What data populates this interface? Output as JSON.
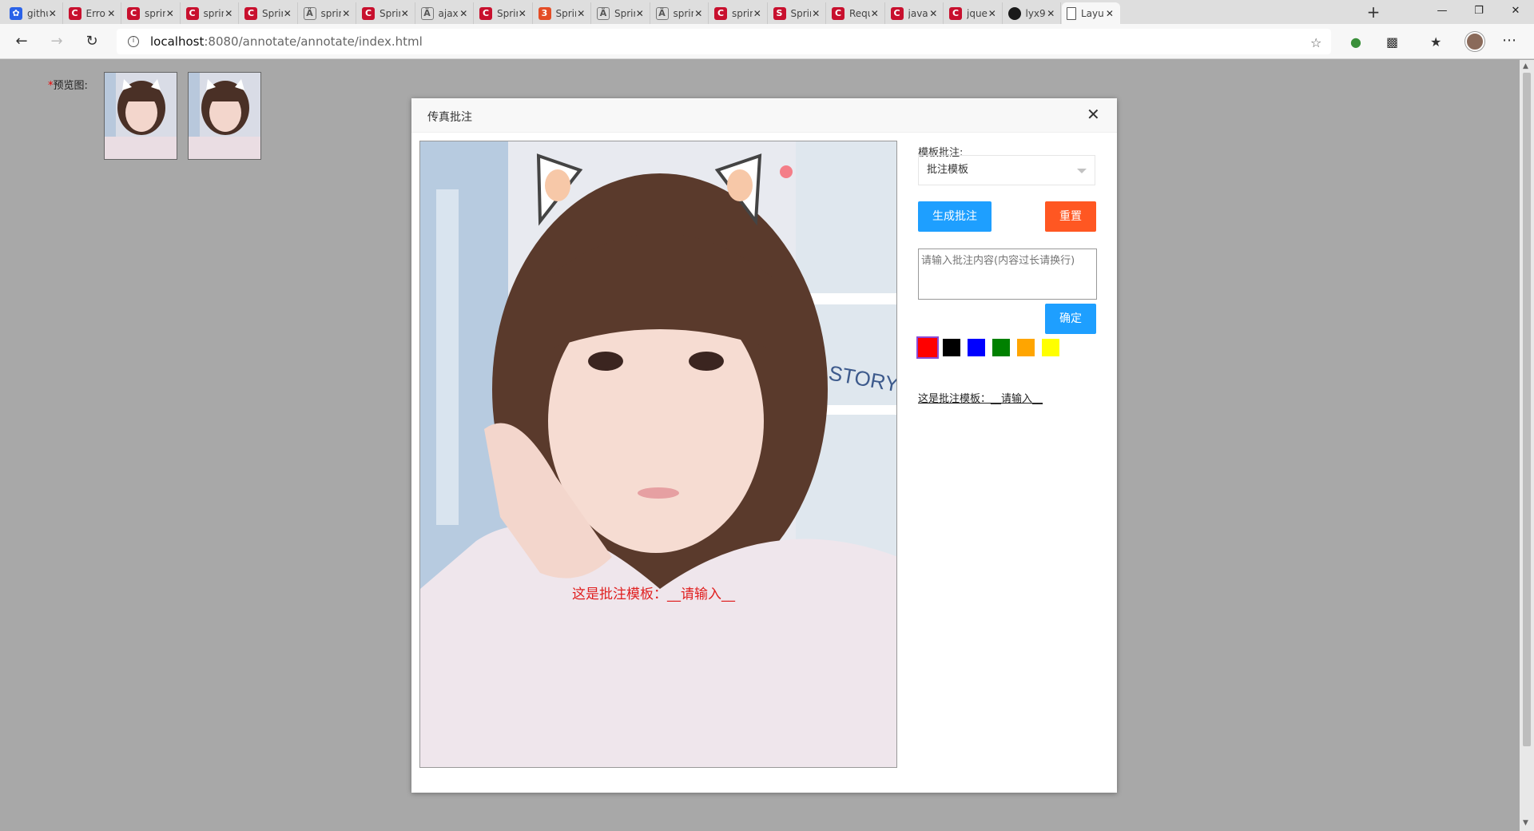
{
  "browser": {
    "tabs": [
      {
        "title": "githu",
        "icon": "paw-icon"
      },
      {
        "title": "Error",
        "icon": "c-icon"
      },
      {
        "title": "sprin",
        "icon": "c-icon"
      },
      {
        "title": "sprin",
        "icon": "c-icon"
      },
      {
        "title": "Sprin",
        "icon": "c-icon"
      },
      {
        "title": "sprin",
        "icon": "jianshu-icon"
      },
      {
        "title": "Sprin",
        "icon": "c-icon"
      },
      {
        "title": "ajax",
        "icon": "jianshu-icon"
      },
      {
        "title": "Sprin",
        "icon": "c-icon"
      },
      {
        "title": "Sprin",
        "icon": "orange-icon"
      },
      {
        "title": "Sprin",
        "icon": "jianshu-icon"
      },
      {
        "title": "sprin",
        "icon": "jianshu-icon"
      },
      {
        "title": "sprin",
        "icon": "c-icon"
      },
      {
        "title": "Sprin",
        "icon": "segmentfault-icon"
      },
      {
        "title": "Requ",
        "icon": "c-icon"
      },
      {
        "title": "java",
        "icon": "c-icon"
      },
      {
        "title": "jque",
        "icon": "c-icon"
      },
      {
        "title": "lyx9",
        "icon": "github-icon"
      },
      {
        "title": "Layu",
        "icon": "page-icon",
        "active": true
      }
    ],
    "url_host": "localhost",
    "url_path": ":8080/annotate/annotate/index.html"
  },
  "page": {
    "preview_required_mark": "*",
    "preview_label": "预览图:"
  },
  "modal": {
    "title": "传真批注",
    "overlay_text": "这是批注模板：__请输入__",
    "template_label": "模板批注:",
    "template_select_value": "批注模板",
    "generate_button": "生成批注",
    "reset_button": "重置",
    "textarea_placeholder": "请输入批注内容(内容过长请换行)",
    "confirm_button": "确定",
    "colors": [
      "#ff0000",
      "#000000",
      "#0000ff",
      "#008000",
      "#ffa500",
      "#ffff00"
    ],
    "selected_color": "#ff0000",
    "template_item": "这是批注模板：__请输入__"
  }
}
